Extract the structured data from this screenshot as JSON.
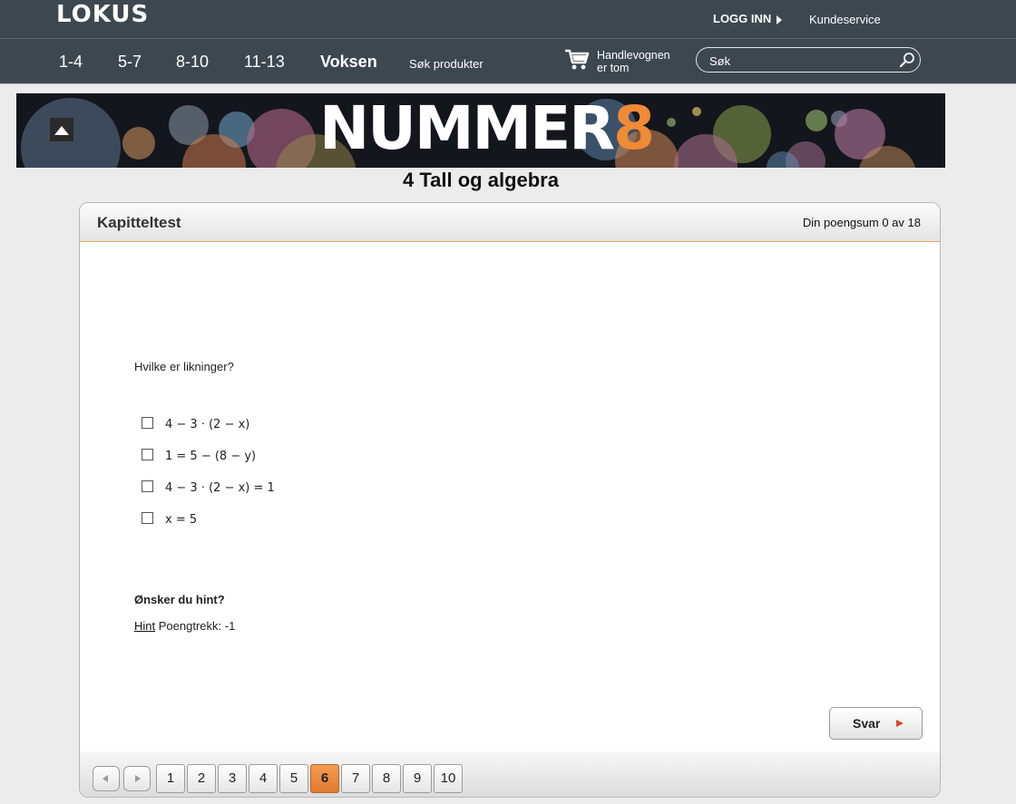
{
  "header": {
    "logo": "LOKUS",
    "login_label": "LOGG INN",
    "customer_service": "Kundeservice"
  },
  "nav": {
    "items": [
      "1-4",
      "5-7",
      "8-10",
      "11-13",
      "Voksen"
    ],
    "search_products": "Søk produkter",
    "cart_line1": "Handlevognen",
    "cart_line2": "er tom",
    "search_placeholder": "Søk"
  },
  "banner": {
    "title_main": "NUMMER",
    "title_accent": "8",
    "accent_color": "#ef8a37"
  },
  "chapter_title": "4 Tall og algebra",
  "panel": {
    "title": "Kapitteltest",
    "score_label": "Din poengsum",
    "score_text": "0 av 18"
  },
  "question": {
    "text": "Hvilke er likninger?",
    "options": [
      "4 − 3 · (2 − x)",
      "1 = 5 − (8 − y)",
      "4 − 3 · (2 − x) = 1",
      "x = 5"
    ]
  },
  "hint": {
    "heading": "Ønsker du hint?",
    "link_label": "Hint",
    "penalty": "Poengtrekk: -1"
  },
  "answer_button": "Svar",
  "pager": {
    "pages": [
      "1",
      "2",
      "3",
      "4",
      "5",
      "6",
      "7",
      "8",
      "9",
      "10"
    ],
    "active_page": "6"
  }
}
